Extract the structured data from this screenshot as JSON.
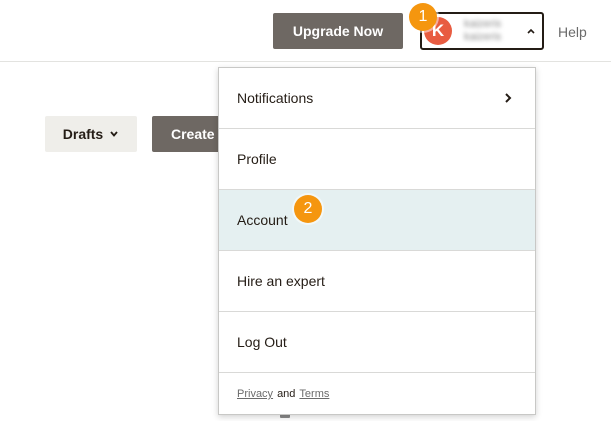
{
  "header": {
    "upgrade_label": "Upgrade Now",
    "avatar_initial": "K",
    "user_line1": "kaizeris",
    "user_line2": "kaizeris",
    "help_label": "Help"
  },
  "steps": {
    "one": "1",
    "two": "2"
  },
  "toolbar": {
    "drafts_label": "Drafts",
    "create_label": "Create"
  },
  "menu": {
    "items": [
      {
        "label": "Notifications"
      },
      {
        "label": "Profile"
      },
      {
        "label": "Account"
      },
      {
        "label": "Hire an expert"
      },
      {
        "label": "Log Out"
      }
    ],
    "footer": {
      "privacy": "Privacy",
      "and": "and",
      "terms": "Terms"
    }
  },
  "colors": {
    "dark_button": "#6e6863",
    "avatar": "#e85c41",
    "step_badge": "#f5960f",
    "active_item": "#e5f0f1"
  },
  "icons": {
    "caret": "chevron-up-icon",
    "drafts_caret": "chevron-down-icon",
    "submenu": "chevron-right-icon"
  }
}
